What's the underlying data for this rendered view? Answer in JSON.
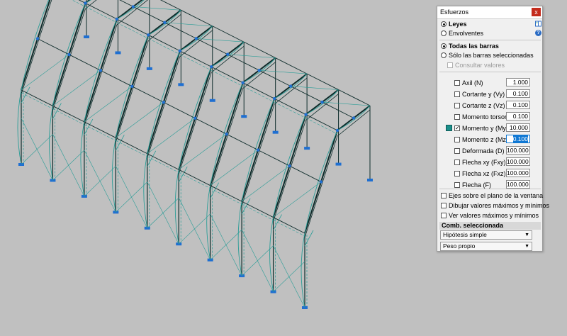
{
  "window": {
    "title": "Esfuerzos",
    "close_label": "x"
  },
  "modes": [
    {
      "label": "Leyes",
      "selected": true
    },
    {
      "label": "Envolventes",
      "selected": false
    }
  ],
  "scope": [
    {
      "label": "Todas las barras",
      "selected": true
    },
    {
      "label": "Sólo las barras seleccionadas",
      "selected": false
    }
  ],
  "consult_label": "Consultar valores",
  "efforts": [
    {
      "label": "Axil (N)",
      "checked": false,
      "value": "1.000"
    },
    {
      "label": "Cortante y (Vy)",
      "checked": false,
      "value": "0.100"
    },
    {
      "label": "Cortante z (Vz)",
      "checked": false,
      "value": "0.100"
    },
    {
      "label": "Momento torsor (Mt)",
      "checked": false,
      "value": "0.100"
    },
    {
      "label": "Momento y (My)",
      "checked": true,
      "value": "10.000",
      "color": "#1b8f8a"
    },
    {
      "label": "Momento z (Mz)",
      "checked": false,
      "value": "0.100"
    },
    {
      "label": "Deformada (D)",
      "checked": false,
      "value": "100.000"
    },
    {
      "label": "Flecha xy (Fxy)",
      "checked": false,
      "value": "100.000"
    },
    {
      "label": "Flecha xz (Fxz)",
      "checked": false,
      "value": "100.000"
    },
    {
      "label": "Flecha (F)",
      "checked": false,
      "value": "100.000"
    }
  ],
  "options": [
    {
      "label": "Ejes sobre el plano de la ventana",
      "checked": false
    },
    {
      "label": "Dibujar valores máximos y mínimos",
      "checked": false
    },
    {
      "label": "Ver valores máximos y mínimos",
      "checked": false
    }
  ],
  "combination": {
    "header": "Comb. seleccionada",
    "type_value": "Hipótesis simple",
    "load_value": "Peso propio"
  },
  "icons": {
    "book": "book-icon",
    "help": "help-icon"
  },
  "colors": {
    "structure": "#0d2b2a",
    "diagram": "#2a9d97",
    "supports": "#1f6fd1",
    "background": "#c0c0c0"
  }
}
